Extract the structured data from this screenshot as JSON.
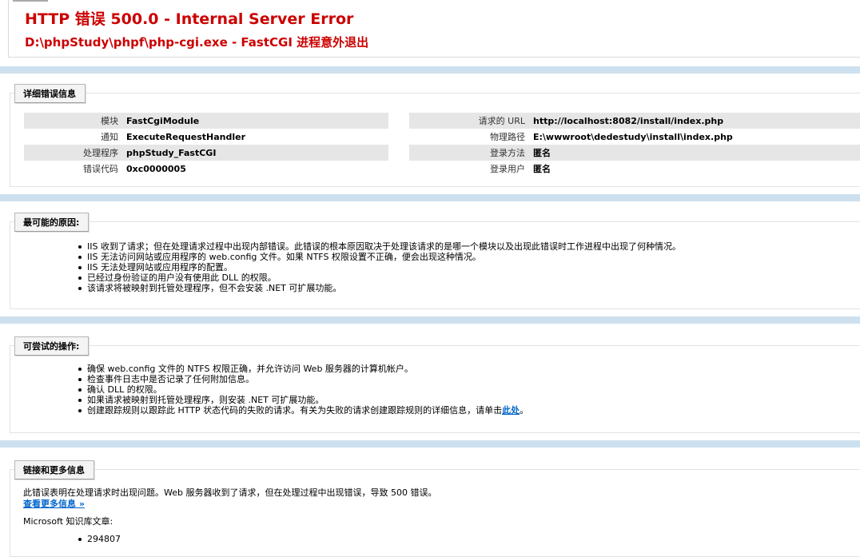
{
  "header": {
    "title": "HTTP 错误 500.0 - Internal Server Error",
    "subtitle": "D:\\phpStudy\\phpf\\php-cgi.exe - FastCGI 进程意外退出"
  },
  "detail": {
    "legend": "详细错误信息",
    "left": [
      {
        "key": "模块",
        "value": "FastCgiModule"
      },
      {
        "key": "通知",
        "value": "ExecuteRequestHandler"
      },
      {
        "key": "处理程序",
        "value": "phpStudy_FastCGI"
      },
      {
        "key": "错误代码",
        "value": "0xc0000005"
      }
    ],
    "right": [
      {
        "key": "请求的 URL",
        "value": "http://localhost:8082/install/index.php"
      },
      {
        "key": "物理路径",
        "value": "E:\\wwwroot\\dedestudy\\install\\index.php"
      },
      {
        "key": "登录方法",
        "value": "匿名"
      },
      {
        "key": "登录用户",
        "value": "匿名"
      }
    ]
  },
  "causes": {
    "legend": "最可能的原因:",
    "items": [
      "IIS 收到了请求；但在处理请求过程中出现内部错误。此错误的根本原因取决于处理该请求的是哪一个模块以及出现此错误时工作进程中出现了何种情况。",
      "IIS 无法访问网站或应用程序的 web.config 文件。如果 NTFS 权限设置不正确，便会出现这种情况。",
      "IIS 无法处理网站或应用程序的配置。",
      "已经过身份验证的用户没有使用此 DLL 的权限。",
      "该请求将被映射到托管处理程序，但不会安装 .NET 可扩展功能。"
    ]
  },
  "actions": {
    "legend": "可尝试的操作:",
    "items": [
      "确保 web.config 文件的 NTFS 权限正确，并允许访问 Web 服务器的计算机帐户。",
      "检查事件日志中是否记录了任何附加信息。",
      "确认 DLL 的权限。",
      "如果请求被映射到托管处理程序，则安装 .NET 可扩展功能。"
    ],
    "last_item_prefix": "创建跟踪规则以跟踪此 HTTP 状态代码的失败的请求。有关为失败的请求创建跟踪规则的详细信息，请单击",
    "last_item_link": "此处",
    "last_item_suffix": "。"
  },
  "links": {
    "legend": "链接和更多信息",
    "description": "此错误表明在处理请求时出现问题。Web 服务器收到了请求，但在处理过程中出现错误，导致 500 错误。",
    "more_link": "查看更多信息 »",
    "kb_label": "Microsoft 知识库文章:",
    "kb_items": [
      "294807"
    ]
  }
}
